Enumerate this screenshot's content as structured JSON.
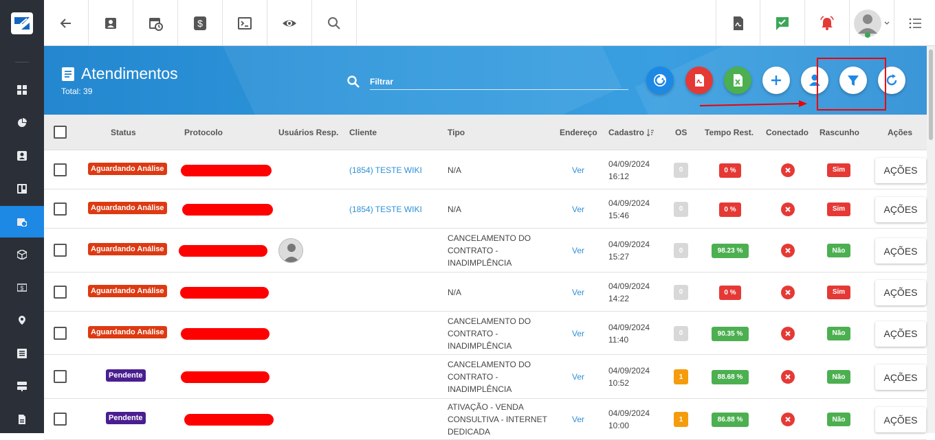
{
  "sidebar": {
    "items": [
      {
        "icon": "dashboard-icon"
      },
      {
        "icon": "pie-chart-icon"
      },
      {
        "icon": "contact-card-icon"
      },
      {
        "icon": "board-icon"
      },
      {
        "icon": "calendar-clock-icon",
        "active": true
      },
      {
        "icon": "box-icon"
      },
      {
        "icon": "money-icon"
      },
      {
        "icon": "map-pin-icon"
      },
      {
        "icon": "document-list-icon"
      },
      {
        "icon": "server-icon"
      },
      {
        "icon": "file-icon"
      }
    ]
  },
  "topbar": {
    "left_buttons": [
      "back-arrow-icon",
      "contact-card-icon",
      "calendar-clock-icon",
      "dollar-icon",
      "terminal-icon",
      "eye-icon",
      "search-icon"
    ],
    "right_buttons": [
      "pdf-file-icon",
      "chat-check-icon",
      "alarm-bell-icon",
      "user-avatar-icon",
      "menu-list-icon"
    ]
  },
  "header": {
    "title": "Atendimentos",
    "total": "Total: 39",
    "filter_placeholder": "Filtrar",
    "actions": [
      {
        "icon": "refresh-circle-icon",
        "color": "#1e88e5"
      },
      {
        "icon": "pdf-icon",
        "color": "#e53935"
      },
      {
        "icon": "excel-icon",
        "color": "#4caf50"
      },
      {
        "icon": "plus-icon",
        "color": "#ffffff"
      },
      {
        "icon": "user-icon",
        "color": "#ffffff"
      },
      {
        "icon": "filter-icon",
        "color": "#ffffff"
      },
      {
        "icon": "reload-icon",
        "color": "#ffffff"
      }
    ]
  },
  "table": {
    "columns": [
      "Status",
      "Protocolo",
      "Usuários Resp.",
      "Cliente",
      "Tipo",
      "Endereço",
      "Cadastro",
      "OS",
      "Tempo Rest.",
      "Conectado",
      "Rascunho",
      "Ações"
    ],
    "rows": [
      {
        "status": "Aguardando Análise",
        "status_kind": "analise",
        "cliente": "(1854) TESTE WIKI",
        "tipo": [
          "N/A"
        ],
        "endereco": "Ver",
        "data": "04/09/2024",
        "hora": "16:12",
        "os": "0",
        "tempo": "0 %",
        "rascunho": "Sim",
        "acoes": "AÇÕES",
        "avatar": false
      },
      {
        "status": "Aguardando Análise",
        "status_kind": "analise",
        "cliente": "(1854) TESTE WIKI",
        "tipo": [
          "N/A"
        ],
        "endereco": "Ver",
        "data": "04/09/2024",
        "hora": "15:46",
        "os": "0",
        "tempo": "0 %",
        "rascunho": "Sim",
        "acoes": "AÇÕES",
        "avatar": false
      },
      {
        "status": "Aguardando Análise",
        "status_kind": "analise",
        "cliente": "",
        "tipo": [
          "CANCELAMENTO DO",
          "CONTRATO -",
          "INADIMPLÊNCIA"
        ],
        "endereco": "Ver",
        "data": "04/09/2024",
        "hora": "15:27",
        "os": "0",
        "tempo": "98.23 %",
        "rascunho": "Não",
        "acoes": "AÇÕES",
        "avatar": true
      },
      {
        "status": "Aguardando Análise",
        "status_kind": "analise",
        "cliente": "",
        "tipo": [
          "N/A"
        ],
        "endereco": "Ver",
        "data": "04/09/2024",
        "hora": "14:22",
        "os": "0",
        "tempo": "0 %",
        "rascunho": "Sim",
        "acoes": "AÇÕES",
        "avatar": false
      },
      {
        "status": "Aguardando Análise",
        "status_kind": "analise",
        "cliente": "",
        "tipo": [
          "CANCELAMENTO DO",
          "CONTRATO -",
          "INADIMPLÊNCIA"
        ],
        "endereco": "Ver",
        "data": "04/09/2024",
        "hora": "11:40",
        "os": "0",
        "tempo": "90.35 %",
        "rascunho": "Não",
        "acoes": "AÇÕES",
        "avatar": false
      },
      {
        "status": "Pendente",
        "status_kind": "pendente",
        "cliente": "",
        "tipo": [
          "CANCELAMENTO DO",
          "CONTRATO -",
          "INADIMPLÊNCIA"
        ],
        "endereco": "Ver",
        "data": "04/09/2024",
        "hora": "10:52",
        "os": "1",
        "tempo": "88.68 %",
        "rascunho": "Não",
        "acoes": "AÇÕES",
        "avatar": false
      },
      {
        "status": "Pendente",
        "status_kind": "pendente",
        "cliente": "",
        "tipo": [
          "ATIVAÇÃO - VENDA",
          "CONSULTIVA - INTERNET",
          "DEDICADA"
        ],
        "endereco": "Ver",
        "data": "04/09/2024",
        "hora": "10:00",
        "os": "1",
        "tempo": "86.88 %",
        "rascunho": "Não",
        "acoes": "AÇÕES",
        "avatar": false
      }
    ]
  },
  "colors": {
    "sidebar": "#2b3038",
    "accent": "#1e88e5",
    "analise": "#dd3a12",
    "pendente": "#4a1e91",
    "annotation": "#e00000"
  }
}
